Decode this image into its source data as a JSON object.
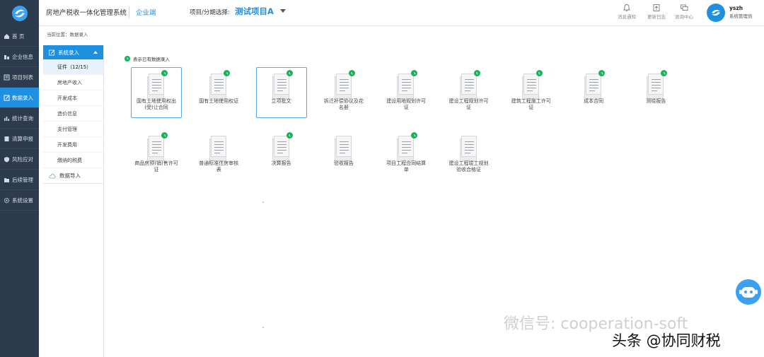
{
  "header": {
    "app_title": "房地产税收一体化管理系统",
    "client_label": "企业端",
    "project_label": "项目/分期选择:",
    "project_value": "测试项目A",
    "tools": [
      {
        "label": "消息通知",
        "icon": "bell-icon"
      },
      {
        "label": "更新日志",
        "icon": "log-icon"
      },
      {
        "label": "咨询中心",
        "icon": "chat-icon"
      }
    ],
    "user": {
      "name": "yszh",
      "role": "系统管理员"
    }
  },
  "main_nav": [
    {
      "label": "首 页",
      "icon": "home-icon",
      "active": false
    },
    {
      "label": "企业信息",
      "icon": "company-icon",
      "active": false
    },
    {
      "label": "项目列表",
      "icon": "list-icon",
      "active": false
    },
    {
      "label": "数据录入",
      "icon": "edit-icon",
      "active": true
    },
    {
      "label": "统计查询",
      "icon": "chart-icon",
      "active": false
    },
    {
      "label": "清算申报",
      "icon": "report-icon",
      "active": false
    },
    {
      "label": "风险应对",
      "icon": "shield-icon",
      "active": false
    },
    {
      "label": "后续管理",
      "icon": "folder-icon",
      "active": false
    },
    {
      "label": "系统设置",
      "icon": "gear-icon",
      "active": false
    }
  ],
  "breadcrumb": "当前位置：数据录入",
  "sub_nav": {
    "header": "系统录入",
    "items": [
      {
        "label": "证件（12/15）",
        "active": true
      },
      {
        "label": "房地产收入",
        "active": false
      },
      {
        "label": "开发成本",
        "active": false
      },
      {
        "label": "造价信息",
        "active": false
      },
      {
        "label": "支付管理",
        "active": false
      },
      {
        "label": "开发费用",
        "active": false
      },
      {
        "label": "缴纳的税费",
        "active": false
      }
    ],
    "import_label": "数据导入"
  },
  "legend": "表示已有数据录入",
  "documents": [
    {
      "label": "国有土地使用权出(受)让合同",
      "has_data": true,
      "selected": true
    },
    {
      "label": "国有土地使用权证",
      "has_data": true,
      "selected": false
    },
    {
      "label": "立项批文",
      "has_data": true,
      "selected": true
    },
    {
      "label": "拆迁补偿协议及花名册",
      "has_data": true,
      "selected": false
    },
    {
      "label": "建设用地规划许可证",
      "has_data": true,
      "selected": false
    },
    {
      "label": "建设工程规划许可证",
      "has_data": true,
      "selected": false
    },
    {
      "label": "建筑工程施工许可证",
      "has_data": true,
      "selected": false
    },
    {
      "label": "成本合同",
      "has_data": true,
      "selected": false
    },
    {
      "label": "测绘报告",
      "has_data": true,
      "selected": false
    },
    {
      "label": "商品房预(销)售许可证",
      "has_data": true,
      "selected": false
    },
    {
      "label": "普通标准住房审核表",
      "has_data": false,
      "selected": false
    },
    {
      "label": "决算报告",
      "has_data": true,
      "selected": false
    },
    {
      "label": "验收报告",
      "has_data": false,
      "selected": false
    },
    {
      "label": "项目工程合同结算单",
      "has_data": true,
      "selected": false
    },
    {
      "label": "建设工程竣工规划验收合格证",
      "has_data": false,
      "selected": false
    }
  ],
  "watermark": {
    "wechat": "微信号: cooperation-soft",
    "toutiao": "头条 @协同财税"
  },
  "colors": {
    "accent": "#1f8fe0",
    "nav_bg": "#2d3b4e",
    "badge": "#19b15a"
  }
}
